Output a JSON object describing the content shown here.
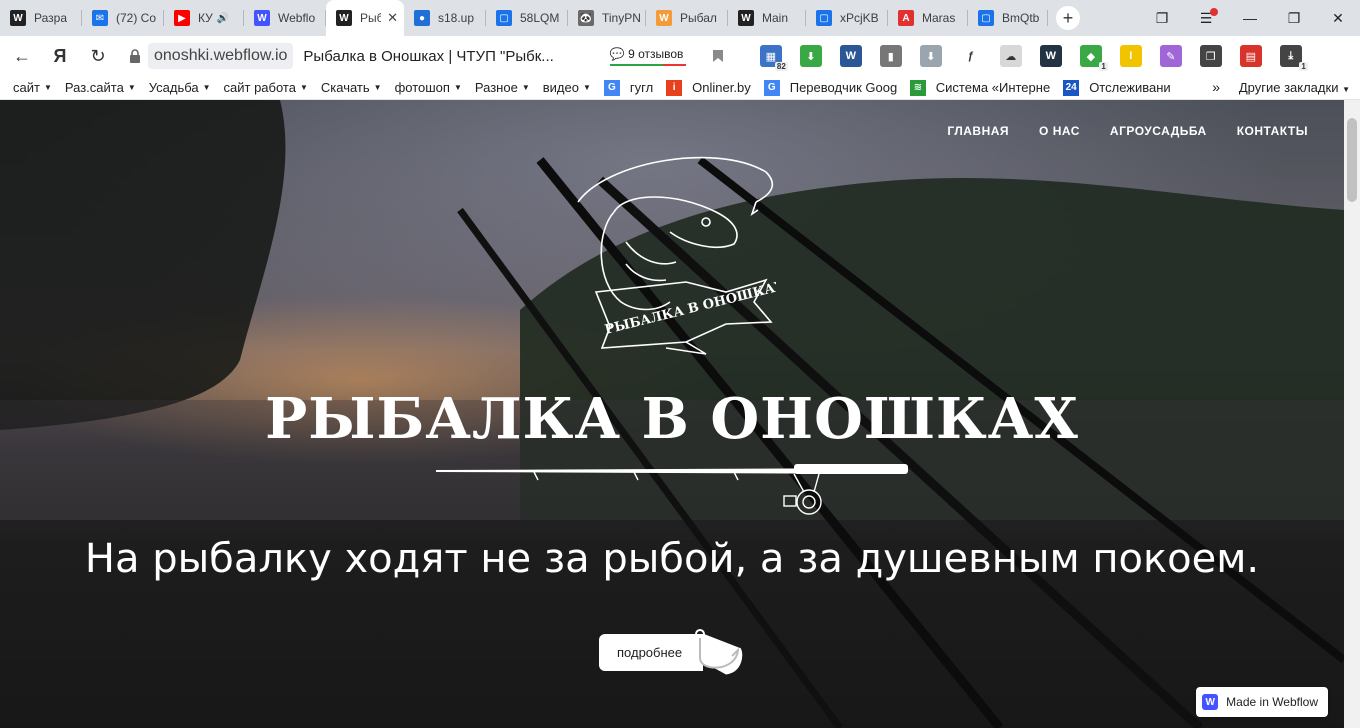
{
  "tabs": [
    {
      "label": "Разра",
      "fav_color": "#222222",
      "fav_letter": "W",
      "icon": "webflow-icon"
    },
    {
      "label": "(72) Co",
      "fav_color": "#1a73e8",
      "fav_letter": "✉",
      "icon": "mail-icon"
    },
    {
      "label": "КУ",
      "fav_color": "#ff0000",
      "fav_letter": "▶",
      "icon": "youtube-icon",
      "audio": true
    },
    {
      "label": "Webflo",
      "fav_color": "#4353ff",
      "fav_letter": "W",
      "icon": "webflow-icon"
    },
    {
      "label": "Рыб",
      "fav_color": "#222222",
      "fav_letter": "W",
      "icon": "webflow-icon",
      "active": true
    },
    {
      "label": "s18.up",
      "fav_color": "#1f6fd6",
      "fav_letter": "●",
      "icon": "upload-icon"
    },
    {
      "label": "58LQM",
      "fav_color": "#1a73e8",
      "fav_letter": "▢",
      "icon": "screenshot-icon"
    },
    {
      "label": "TinyPN",
      "fav_color": "#6a6a6a",
      "fav_letter": "🐼",
      "icon": "panda-icon"
    },
    {
      "label": "Рыбал",
      "fav_color": "#f29b38",
      "fav_letter": "W",
      "icon": "webflow-orange-icon"
    },
    {
      "label": "Main",
      "fav_color": "#222222",
      "fav_letter": "W",
      "icon": "webflow-icon"
    },
    {
      "label": "xPcjKB",
      "fav_color": "#1a73e8",
      "fav_letter": "▢",
      "icon": "screenshot-icon"
    },
    {
      "label": "Maras",
      "fav_color": "#e03030",
      "fav_letter": "A",
      "icon": "acrobat-icon"
    },
    {
      "label": "BmQtb",
      "fav_color": "#1a73e8",
      "fav_letter": "▢",
      "icon": "screenshot-icon"
    }
  ],
  "address": {
    "host": "onoshki.webflow.io",
    "title": "Рыбалка в Оношках | ЧТУП \"Рыбк...",
    "reviews": "9 отзывов"
  },
  "extensions": [
    {
      "icon": "calendar-icon",
      "color": "#3d73c6",
      "letter": "▦",
      "count": "82"
    },
    {
      "icon": "download-green-icon",
      "color": "#3aa845",
      "letter": "⬇"
    },
    {
      "icon": "word-icon",
      "color": "#2b5797",
      "letter": "W"
    },
    {
      "icon": "panels-icon",
      "color": "#777777",
      "letter": "▮"
    },
    {
      "icon": "download-gray-icon",
      "color": "#9aa5b0",
      "letter": "⬇"
    },
    {
      "icon": "script-icon",
      "color": "#ffffff",
      "letter": "ƒ"
    },
    {
      "icon": "cloud-icon",
      "color": "#d8d8d8",
      "letter": "☁"
    },
    {
      "icon": "webflow-ext-icon",
      "color": "#223344",
      "letter": "W"
    },
    {
      "icon": "shield-icon",
      "color": "#3aa845",
      "letter": "◆",
      "count": "1"
    },
    {
      "icon": "yellow-icon",
      "color": "#f2c400",
      "letter": "I"
    },
    {
      "icon": "pen-icon",
      "color": "#a066d8",
      "letter": "✎"
    },
    {
      "icon": "collections-icon",
      "color": "#444444",
      "letter": "❐"
    },
    {
      "icon": "pdf-icon",
      "color": "#d9342b",
      "letter": "▤"
    },
    {
      "icon": "downloads-icon",
      "color": "#444444",
      "letter": "⤓",
      "count": "1"
    }
  ],
  "bookmarks": [
    {
      "label": "сайт",
      "folder": true
    },
    {
      "label": "Раз.сайта",
      "folder": true
    },
    {
      "label": "Усадьба",
      "folder": true
    },
    {
      "label": "сайт работа",
      "folder": true
    },
    {
      "label": "Скачать",
      "folder": true
    },
    {
      "label": "фотошоп",
      "folder": true
    },
    {
      "label": "Разное",
      "folder": true
    },
    {
      "label": "видео",
      "folder": true
    },
    {
      "label": "гугл",
      "icon": "google-icon",
      "color": "#4285f4",
      "letter": "G"
    },
    {
      "label": "Onliner.by",
      "icon": "onliner-icon",
      "color": "#e8401c",
      "letter": "i"
    },
    {
      "label": "Переводчик Goog",
      "icon": "translate-icon",
      "color": "#4285f4",
      "letter": "G"
    },
    {
      "label": "Система «Интерне",
      "icon": "system-icon",
      "color": "#2a9a3a",
      "letter": "≋"
    },
    {
      "label": "Отслеживани",
      "icon": "tracking-icon",
      "color": "#1a56c4",
      "letter": "24"
    }
  ],
  "bookmarks_more": "»",
  "bookmarks_other": "Другие закладки",
  "site": {
    "nav": [
      "ГЛАВНАЯ",
      "О НАС",
      "АГРОУСАДЬБА",
      "КОНТАКТЫ"
    ],
    "logo_ribbon": "РЫБАЛКА В ОНОШКАХ",
    "title": "РЫБАЛКА В ОНОШКАХ",
    "subtitle": "На рыбалку ходят не за рыбой, а за душевным покоем.",
    "more_button": "подробнее",
    "made_in_webflow": "Made in Webflow"
  }
}
